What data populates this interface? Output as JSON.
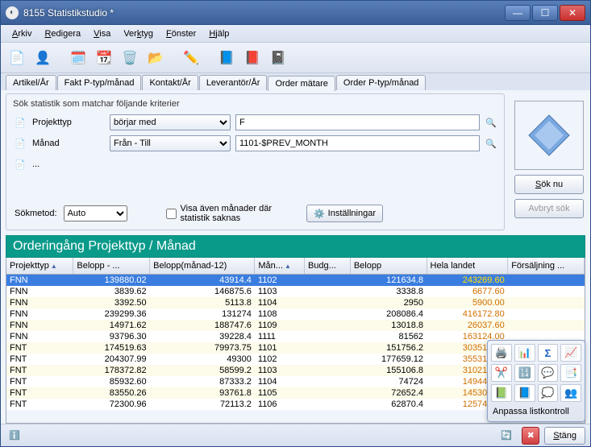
{
  "window": {
    "title": "8155 Statistikstudio *"
  },
  "menus": {
    "arkiv": "Arkiv",
    "redigera": "Redigera",
    "visa": "Visa",
    "verktyg": "Verktyg",
    "fonster": "Fönster",
    "hjalp": "Hjälp"
  },
  "tabs": {
    "t0": "Artikel/År",
    "t1": "Fakt P-typ/månad",
    "t2": "Kontakt/År",
    "t3": "Leverantör/År",
    "t4": "Order mätare",
    "t5": "Order P-typ/månad"
  },
  "search": {
    "group_label": "Sök statistik som matchar följande kriterier",
    "row1": {
      "label": "Projekttyp",
      "op": "börjar med",
      "value": "F"
    },
    "row2": {
      "label": "Månad",
      "op": "Från - Till",
      "value": "1101-$PREV_MONTH"
    },
    "row3": {
      "label": "..."
    },
    "method_label": "Sökmetod:",
    "method_value": "Auto",
    "show_missing": "Visa även månader där statistik saknas",
    "settings": "Inställningar",
    "search_now": "Sök nu",
    "cancel_search": "Avbryt sök"
  },
  "grid": {
    "title": "Orderingång Projekttyp / Månad",
    "headers": {
      "c0": "Projekttyp",
      "c1": "Belopp - ...",
      "c2": "Belopp(månad-12)",
      "c3": "Mån...",
      "c4": "Budg...",
      "c5": "Belopp",
      "c6": "Hela landet",
      "c7": "Försäljning ..."
    },
    "rows": [
      {
        "c0": "FNN",
        "c1": "139880.02",
        "c2": "43914.4",
        "c3": "1102",
        "c5": "121634.8",
        "c6": "243269.60"
      },
      {
        "c0": "FNN",
        "c1": "3839.62",
        "c2": "146875.6",
        "c3": "1103",
        "c5": "3338.8",
        "c6": "6677.60"
      },
      {
        "c0": "FNN",
        "c1": "3392.50",
        "c2": "5113.8",
        "c3": "1104",
        "c5": "2950",
        "c6": "5900.00"
      },
      {
        "c0": "FNN",
        "c1": "239299.36",
        "c2": "131274",
        "c3": "1108",
        "c5": "208086.4",
        "c6": "416172.80"
      },
      {
        "c0": "FNN",
        "c1": "14971.62",
        "c2": "188747.6",
        "c3": "1109",
        "c5": "13018.8",
        "c6": "26037.60"
      },
      {
        "c0": "FNN",
        "c1": "93796.30",
        "c2": "39228.4",
        "c3": "1111",
        "c5": "81562",
        "c6": "163124.00"
      },
      {
        "c0": "FNT",
        "c1": "174519.63",
        "c2": "79973.75",
        "c3": "1101",
        "c5": "151756.2",
        "c6": "303512.40"
      },
      {
        "c0": "FNT",
        "c1": "204307.99",
        "c2": "49300",
        "c3": "1102",
        "c5": "177659.12",
        "c6": "355318.24"
      },
      {
        "c0": "FNT",
        "c1": "178372.82",
        "c2": "58599.2",
        "c3": "1103",
        "c5": "155106.8",
        "c6": "310213.60"
      },
      {
        "c0": "FNT",
        "c1": "85932.60",
        "c2": "87333.2",
        "c3": "1104",
        "c5": "74724",
        "c6": "149448.00"
      },
      {
        "c0": "FNT",
        "c1": "83550.26",
        "c2": "93761.8",
        "c3": "1105",
        "c5": "72652.4",
        "c6": "145304.80"
      },
      {
        "c0": "FNT",
        "c1": "72300.96",
        "c2": "72113.2",
        "c3": "1106",
        "c5": "62870.4",
        "c6": "125740.80"
      }
    ]
  },
  "popup": {
    "caption": "Anpassa listkontroll"
  },
  "footer": {
    "close": "Stäng"
  },
  "icons": {
    "doc": "📄",
    "user_add": "👤",
    "cal_add": "🗓️",
    "cal_edit": "📆",
    "cal_del": "🗑️",
    "folder": "📂",
    "edit": "✏️",
    "book_blue": "📘",
    "book_red": "📕",
    "book_purple": "📓",
    "mag": "🔍",
    "gear": "⚙️",
    "info": "ℹ️",
    "print": "🖨️",
    "chart": "📊",
    "sigma": "Σ",
    "plot_add": "📈",
    "pen_red": "✂️",
    "num": "🔢",
    "bubble_add": "💬",
    "rep_add": "📑",
    "excel": "📗",
    "word": "📘",
    "bubble": "💭",
    "users": "👥",
    "refresh": "🔄",
    "close_x": "✖"
  }
}
